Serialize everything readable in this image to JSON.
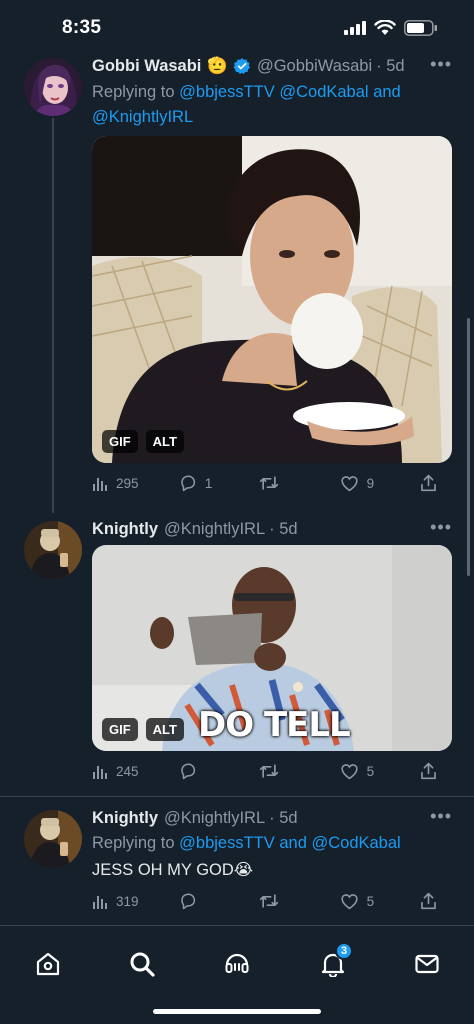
{
  "status_bar": {
    "time": "8:35"
  },
  "tweets": [
    {
      "display_name": "Gobbi Wasabi",
      "emoji": "🫡",
      "verified": true,
      "handle": "@GobbiWasabi",
      "time": "· 5d",
      "reply_prefix": "Replying to",
      "mentions": [
        "@bbjessTTV",
        "@CodKabal"
      ],
      "mention_joiner": "and",
      "mention_last": "@KnightlyIRL",
      "media": {
        "badges": [
          "GIF",
          "ALT"
        ]
      },
      "stats": {
        "views": "295",
        "replies": "1",
        "retweets": "",
        "likes": "9"
      }
    },
    {
      "display_name": "Knightly",
      "handle": "@KnightlyIRL",
      "time": "· 5d",
      "media": {
        "badges": [
          "GIF",
          "ALT"
        ],
        "caption": "DO TELL"
      },
      "stats": {
        "views": "245",
        "replies": "",
        "retweets": "",
        "likes": "5"
      }
    },
    {
      "display_name": "Knightly",
      "handle": "@KnightlyIRL",
      "time": "· 5d",
      "reply_prefix": "Replying to",
      "mentions": [
        "@bbjessTTV"
      ],
      "mention_joiner": "and",
      "mention_last": "@CodKabal",
      "text": "JESS OH MY GOD😭",
      "stats": {
        "views": "319",
        "replies": "",
        "retweets": "",
        "likes": "5"
      }
    }
  ],
  "tab_bar": {
    "items": [
      "home-icon",
      "search-icon",
      "spaces-icon",
      "notifications-icon",
      "messages-icon"
    ],
    "notification_count": "3"
  },
  "colors": {
    "background": "#15202b",
    "accent": "#1d9bf0",
    "muted": "#8b98a5",
    "divider": "#38444d"
  }
}
